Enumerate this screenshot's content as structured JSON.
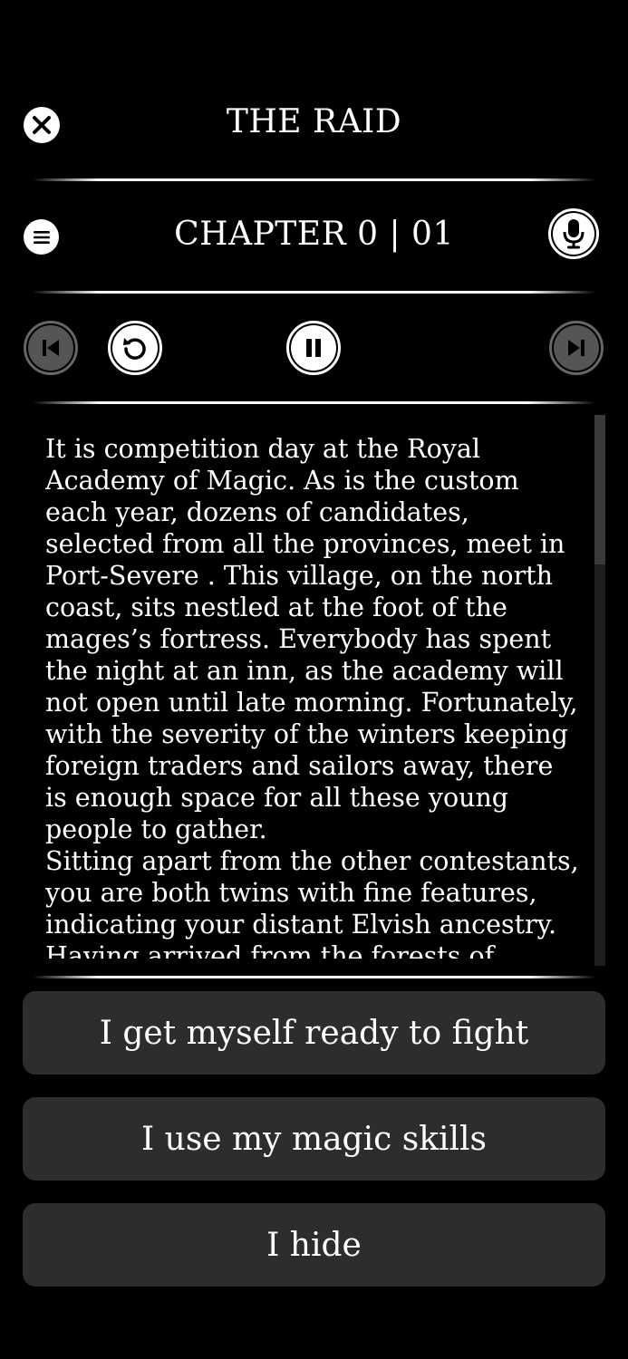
{
  "header": {
    "title": "THE RAID",
    "chapter": "CHAPTER 0 | 01"
  },
  "icons": {
    "close": "close-icon",
    "menu": "menu-icon",
    "mic": "microphone-icon",
    "prev": "skip-previous-icon",
    "replay": "replay-icon",
    "pause": "pause-icon",
    "next": "skip-next-icon"
  },
  "story": {
    "paragraphs": [
      "It is competition day at the Royal Academy of Magic. As is the custom each year, dozens of candidates, selected from all the provinces, meet in Port-Severe . This village, on the north coast, sits nestled at the foot of the mages’s fortress. Everybody has spent the night at an inn, as the academy will not open until late morning. Fortunately, with the severity of the winters keeping foreign traders and sailors away, there is enough space for all these young people to gather.",
      "Sitting apart from the other contestants, you are both twins with fine features, indicating your distant Elvish ancestry. Having arrived from the forests of Gonaril, you are discovering the sea for"
    ]
  },
  "choices": [
    {
      "label": "I get myself ready to fight"
    },
    {
      "label": "I use my magic skills"
    },
    {
      "label": "I hide"
    }
  ],
  "colors": {
    "background": "#000000",
    "foreground": "#ffffff",
    "choice_bg": "#2d2d2d",
    "disabled": "#555555"
  }
}
